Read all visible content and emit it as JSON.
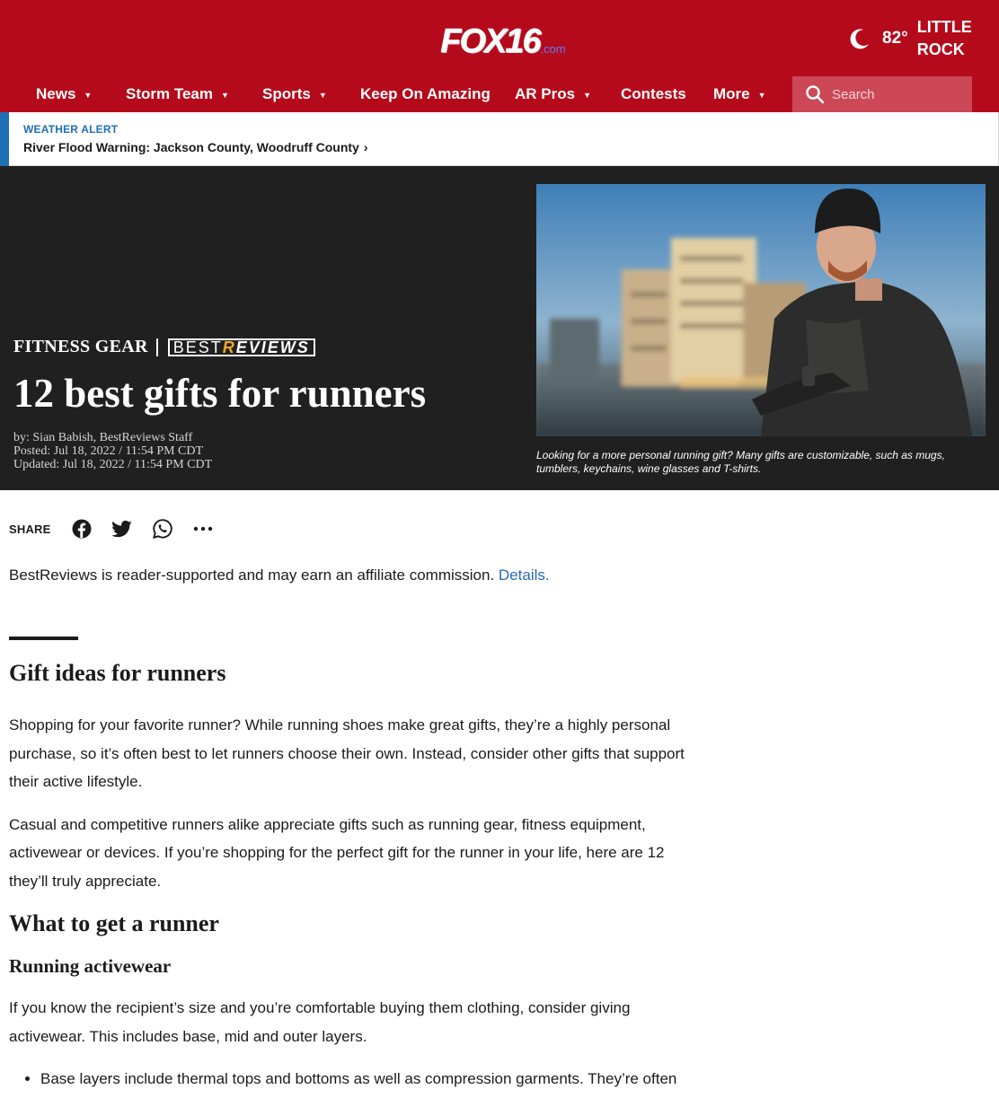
{
  "header": {
    "logo_main": "FOX16",
    "logo_suffix": ".com",
    "weather": {
      "temperature": "82°",
      "city": "LITTLE ROCK",
      "icon": "moon-icon"
    },
    "nav": [
      {
        "label": "News",
        "dropdown": true
      },
      {
        "label": "Storm Team",
        "dropdown": true
      },
      {
        "label": "Sports",
        "dropdown": true
      },
      {
        "label": "Keep On Amazing",
        "dropdown": false
      },
      {
        "label": "AR Pros",
        "dropdown": true
      },
      {
        "label": "Contests",
        "dropdown": false
      },
      {
        "label": "More",
        "dropdown": true
      }
    ],
    "search_placeholder": "Search",
    "colors": {
      "brand": "#b50a1b",
      "search_bg": "#cd4856",
      "alert_accent": "#1f6fb5"
    }
  },
  "alert": {
    "label": "WEATHER ALERT",
    "text": "River Flood Warning: Jackson County, Woodruff County",
    "chevron": "›"
  },
  "hero": {
    "category": "FITNESS GEAR",
    "partner_best": "BEST",
    "partner_rest": "EVIEWS",
    "partner_crown": "R",
    "title": "12 best gifts for runners",
    "byline": "by: Sian Babish, BestReviews Staff",
    "posted": "Posted: Jul 18, 2022 / 11:54 PM CDT",
    "updated": "Updated: Jul 18, 2022 / 11:54 PM CDT",
    "caption": "Looking for a more personal running gift? Many gifts are customizable, such as mugs, tumblers, keychains, wine glasses and T-shirts."
  },
  "share": {
    "label": "SHARE",
    "buttons": [
      "facebook-icon",
      "twitter-icon",
      "whatsapp-icon",
      "more-icon"
    ]
  },
  "disclosure": {
    "text": "BestReviews is reader-supported and may earn an affiliate commission.",
    "link": "Details."
  },
  "article": {
    "heading": "Gift ideas for runners",
    "p1": "Shopping for your favorite runner? While running shoes make great gifts, they’re a highly personal purchase, so it’s often best to let runners choose their own. Instead, consider other gifts that support their active lifestyle.",
    "p2": "Casual and competitive runners alike appreciate gifts such as running gear, fitness equipment, activewear or devices. If you’re shopping for the perfect gift for the runner in your life, here are 12 they’ll truly appreciate.",
    "h2b": "What to get a runner",
    "h3": "Running activewear",
    "p3": "If you know the recipient’s size and you’re comfortable buying them clothing, consider giving activewear. This includes base, mid and outer layers.",
    "li1": "Base layers include thermal tops and bottoms as well as compression garments. They’re often"
  }
}
